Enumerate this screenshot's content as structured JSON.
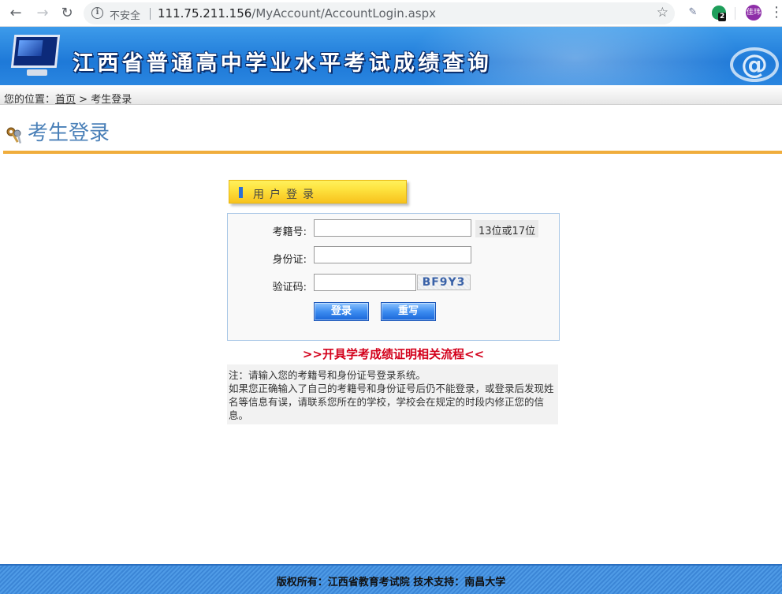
{
  "browser": {
    "security_label": "不安全",
    "url_host": "111.75.211.156",
    "url_path": "/MyAccount/AccountLogin.aspx",
    "extension_badge": "2",
    "profile_initials": "佳玮"
  },
  "banner": {
    "title": "江西省普通高中学业水平考试成绩查询"
  },
  "breadcrumb": {
    "prefix": "您的位置：",
    "home": "首页",
    "separator": " > ",
    "current": "考生登录"
  },
  "page": {
    "title": "考生登录"
  },
  "login": {
    "tab_label": "用户登录",
    "exam_id_label": "考籍号:",
    "exam_id_value": "",
    "exam_id_hint": "13位或17位",
    "id_card_label": "身份证:",
    "id_card_value": "",
    "captcha_label": "验证码:",
    "captcha_value": "",
    "captcha_text": "BF9Y3",
    "login_button": "登录",
    "reset_button": "重写"
  },
  "process_link": ">>开具学考成绩证明相关流程<<",
  "note": {
    "line1": "注：请输入您的考籍号和身份证号登录系统。",
    "line2": "如果您正确输入了自己的考籍号和身份证号后仍不能登录，或登录后发现姓名等信息有误，请联系您所在的学校，学校会在规定的时段内修正您的信息。"
  },
  "footer": {
    "copyright": "版权所有：江西省教育考试院 技术支持：南昌大学"
  }
}
